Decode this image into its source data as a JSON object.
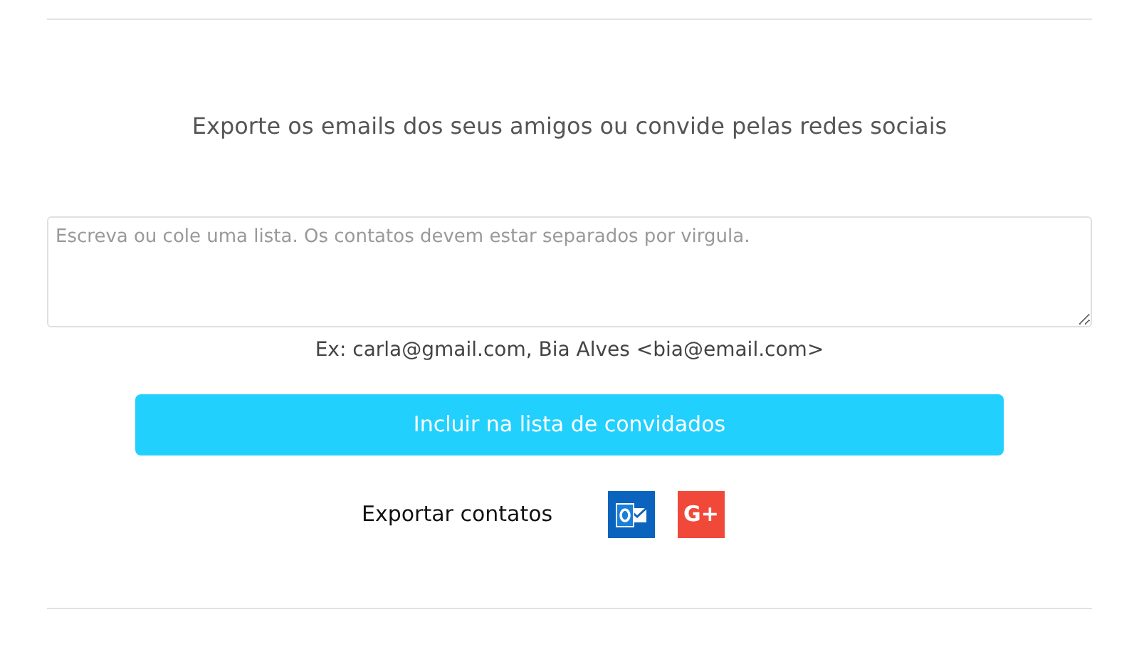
{
  "heading": "Exporte os emails dos seus amigos ou convide pelas redes sociais",
  "list_field": {
    "placeholder": "Escreva ou cole uma lista. Os contatos devem estar separados por virgula."
  },
  "example": "Ex: carla@gmail.com, Bia Alves <bia@email.com>",
  "submit_button": "Incluir na lista de convidados",
  "export": {
    "label": "Exportar contatos",
    "services": [
      {
        "kind": "outlook"
      },
      {
        "kind": "google_plus",
        "text": "G+"
      }
    ]
  }
}
